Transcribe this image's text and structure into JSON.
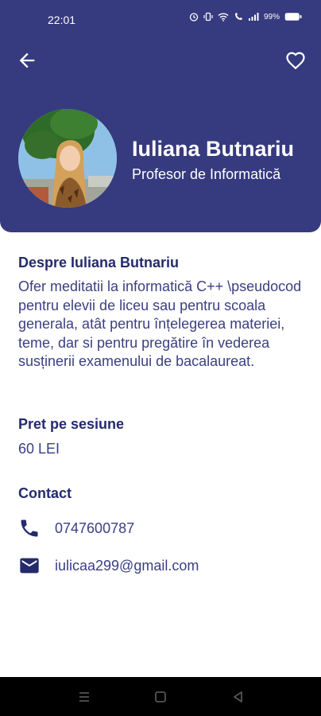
{
  "status_bar": {
    "time": "22:01",
    "battery": "99%"
  },
  "header": {
    "name": "Iuliana Butnariu",
    "role": "Profesor de Informatică"
  },
  "about": {
    "title": "Despre Iuliana Butnariu",
    "text": "Ofer meditatii la informatică C++ \\pseudocod pentru elevii de liceu sau pentru scoala generala, atât pentru înțelegerea materiei, teme, dar si pentru pregătire în vederea susținerii examenului de bacalaureat."
  },
  "price": {
    "title": "Pret pe sesiune",
    "value": "60 LEI"
  },
  "contact": {
    "title": "Contact",
    "phone": "0747600787",
    "email": "iulicaa299@gmail.com"
  },
  "icons": {
    "back": "arrow-left-icon",
    "favorite": "heart-outline-icon",
    "phone": "phone-icon",
    "email": "email-icon"
  },
  "colors": {
    "header_bg": "#363a7e",
    "title": "#242a6c",
    "text": "#3a3f82"
  }
}
